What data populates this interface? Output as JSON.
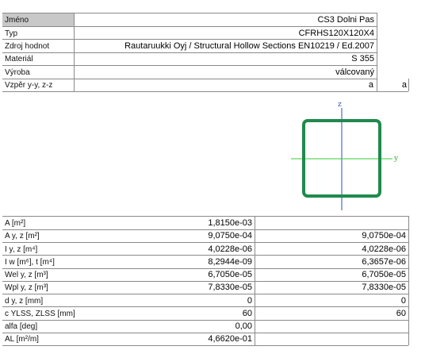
{
  "header_rows": [
    {
      "label": "Jméno",
      "value": "CS3 Dolni Pas"
    },
    {
      "label": "Typ",
      "value": "CFRHS120X120X4"
    },
    {
      "label": "Zdroj hodnot",
      "value": "Rautaruukki Oyj / Structural Hollow Sections EN10219 / Ed.2007"
    },
    {
      "label": "Materiál",
      "value": "S 355"
    },
    {
      "label": "Výroba",
      "value": "válcovaný"
    }
  ],
  "buckling": {
    "label": "Vzpěr y-y, z-z",
    "value_y": "a",
    "value_z": "a"
  },
  "section_figure": {
    "axis_z": "z",
    "axis_y": "y",
    "colors": {
      "profile": "#1f8a4c",
      "y_axis": "#33cc33",
      "z_axis": "#2e4fae"
    }
  },
  "properties": [
    {
      "label": "A [m²]",
      "value1": "1,8150e-03",
      "value2": ""
    },
    {
      "label": "A y, z [m²]",
      "value1": "9,0750e-04",
      "value2": "9,0750e-04"
    },
    {
      "label": "I y, z [m⁴]",
      "value1": "4,0228e-06",
      "value2": "4,0228e-06"
    },
    {
      "label": "I w [m⁶], t [m⁴]",
      "value1": "8,2944e-09",
      "value2": "6,3657e-06"
    },
    {
      "label": "Wel y, z [m³]",
      "value1": "6,7050e-05",
      "value2": "6,7050e-05"
    },
    {
      "label": "Wpl y, z [m³]",
      "value1": "7,8330e-05",
      "value2": "7,8330e-05"
    },
    {
      "label": "d y, z [mm]",
      "value1": "0",
      "value2": "0"
    },
    {
      "label": "c YLSS, ZLSS [mm]",
      "value1": "60",
      "value2": "60"
    },
    {
      "label": "alfa [deg]",
      "value1": "0,00",
      "value2": ""
    },
    {
      "label": "AL [m²/m]",
      "value1": "4,6620e-01",
      "value2": ""
    }
  ]
}
